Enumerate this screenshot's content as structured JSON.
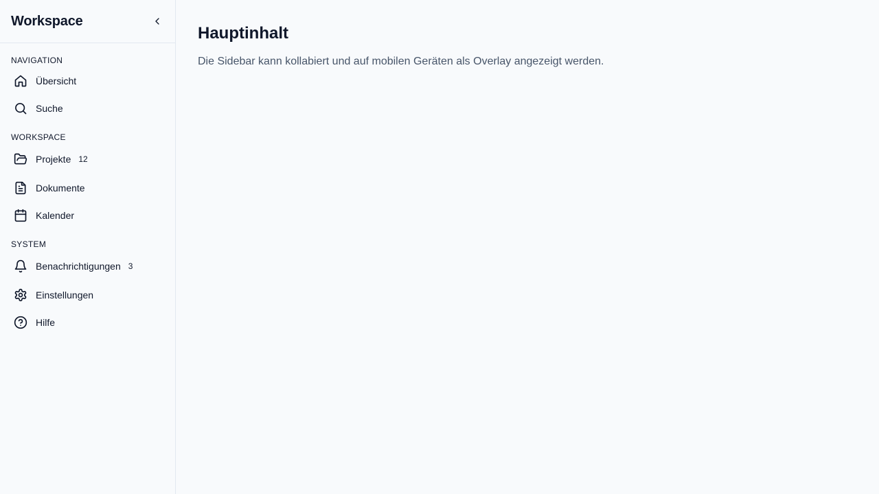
{
  "sidebar": {
    "title": "Workspace",
    "collapse_icon": "chevron-left-icon",
    "sections": [
      {
        "label": "NAVIGATION",
        "items": [
          {
            "label": "Übersicht",
            "icon": "home-icon",
            "badge": null
          },
          {
            "label": "Suche",
            "icon": "search-icon",
            "badge": null
          }
        ]
      },
      {
        "label": "WORKSPACE",
        "items": [
          {
            "label": "Projekte",
            "icon": "folder-open-icon",
            "badge": "12"
          },
          {
            "label": "Dokumente",
            "icon": "file-text-icon",
            "badge": null
          },
          {
            "label": "Kalender",
            "icon": "calendar-icon",
            "badge": null
          }
        ]
      },
      {
        "label": "SYSTEM",
        "items": [
          {
            "label": "Benachrichtigungen",
            "icon": "bell-icon",
            "badge": "3"
          },
          {
            "label": "Einstellungen",
            "icon": "gear-icon",
            "badge": null
          },
          {
            "label": "Hilfe",
            "icon": "help-circle-icon",
            "badge": null
          }
        ]
      }
    ]
  },
  "main": {
    "title": "Hauptinhalt",
    "description": "Die Sidebar kann kollabiert und auf mobilen Geräten als Overlay angezeigt werden."
  },
  "colors": {
    "background": "#f8fafc",
    "text": "#0f172a",
    "muted_text": "#475569",
    "border": "#e2e8f0"
  }
}
